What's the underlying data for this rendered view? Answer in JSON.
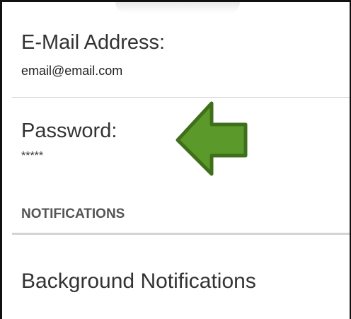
{
  "settings": {
    "email": {
      "title": "E-Mail Address:",
      "summary": "email@email.com"
    },
    "password": {
      "title": "Password:",
      "summary": "*****"
    },
    "notifications_category": "NOTIFICATIONS",
    "background_notifications": {
      "title": "Background Notifications"
    }
  },
  "annotation": {
    "icon": "left-arrow-icon",
    "fill": "#5b9a2a",
    "stroke": "#3f6f1b"
  }
}
